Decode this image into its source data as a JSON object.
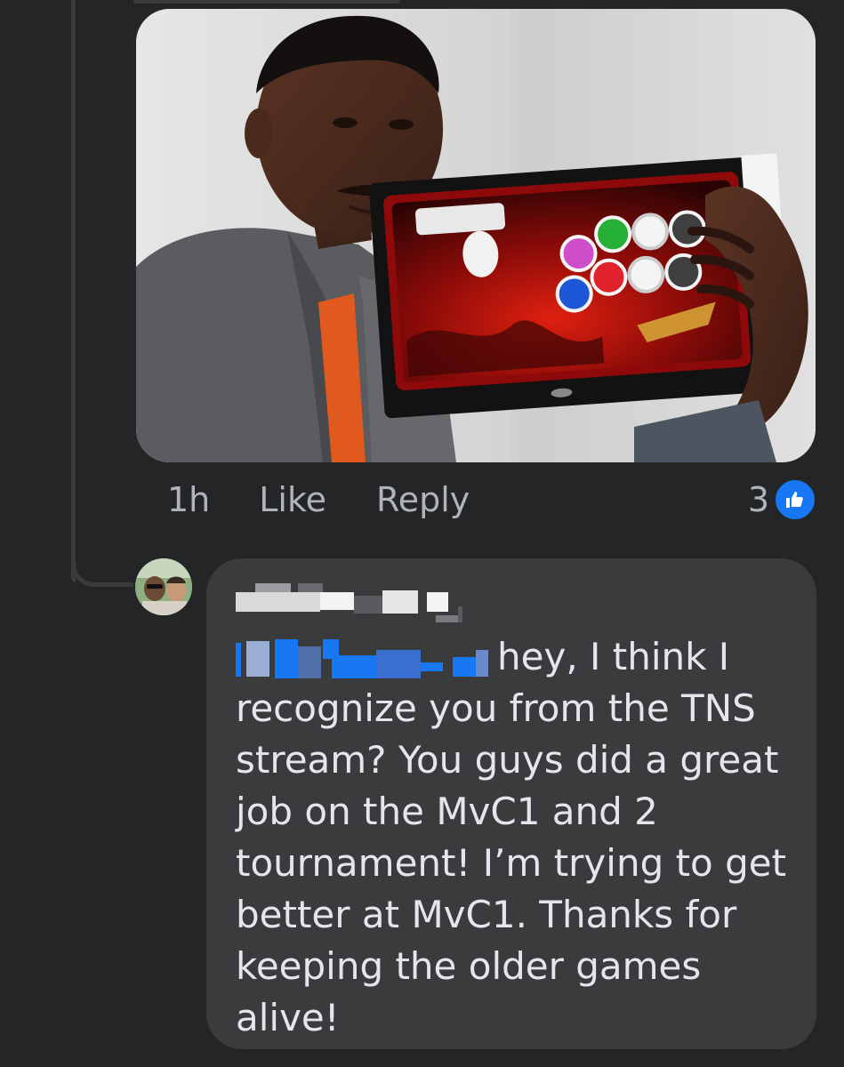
{
  "comment": {
    "timestamp": "1h",
    "like_label": "Like",
    "reply_label": "Reply",
    "reaction_count": "3",
    "reaction_icon": "thumbs-up-icon"
  },
  "reply": {
    "author_name_redacted": true,
    "mention_redacted": true,
    "body": "hey, I think I recognize you from the TNS stream? You guys did a great job on the MvC1 and 2 tournament! I’m trying to get better at MvC1. Thanks for keeping the older games alive!"
  },
  "colors": {
    "background": "#242526",
    "bubble": "#3a3b3c",
    "text": "#e4e6eb",
    "muted_text": "#b0b3b8",
    "accent": "#1877f2"
  }
}
